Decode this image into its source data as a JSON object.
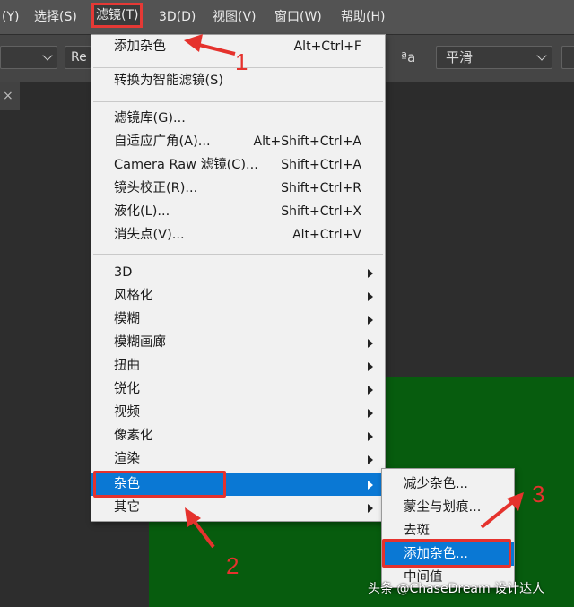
{
  "menubar": {
    "items": [
      {
        "label": "(Y)"
      },
      {
        "label": "选择(S)"
      },
      {
        "label": "滤镜(T)"
      },
      {
        "label": "3D(D)"
      },
      {
        "label": "视图(V)"
      },
      {
        "label": "窗口(W)"
      },
      {
        "label": "帮助(H)"
      }
    ]
  },
  "options_bar": {
    "font_style_value": "Re",
    "aa_icon": "aa-antialias-icon",
    "antialias_value": "平滑"
  },
  "tab": {
    "close_glyph": "×"
  },
  "filter_menu": {
    "items": [
      {
        "label": "添加杂色",
        "shortcut": "Alt+Ctrl+F"
      },
      {
        "label": "转换为智能滤镜(S)",
        "shortcut": ""
      },
      {
        "label": "滤镜库(G)...",
        "shortcut": ""
      },
      {
        "label": "自适应广角(A)...",
        "shortcut": "Alt+Shift+Ctrl+A"
      },
      {
        "label": "Camera Raw 滤镜(C)...",
        "shortcut": "Shift+Ctrl+A"
      },
      {
        "label": "镜头校正(R)...",
        "shortcut": "Shift+Ctrl+R"
      },
      {
        "label": "液化(L)...",
        "shortcut": "Shift+Ctrl+X"
      },
      {
        "label": "消失点(V)...",
        "shortcut": "Alt+Ctrl+V"
      },
      {
        "label": "3D"
      },
      {
        "label": "风格化"
      },
      {
        "label": "模糊"
      },
      {
        "label": "模糊画廊"
      },
      {
        "label": "扭曲"
      },
      {
        "label": "锐化"
      },
      {
        "label": "视频"
      },
      {
        "label": "像素化"
      },
      {
        "label": "渲染"
      },
      {
        "label": "杂色"
      },
      {
        "label": "其它"
      }
    ]
  },
  "noise_submenu": {
    "items": [
      {
        "label": "减少杂色..."
      },
      {
        "label": "蒙尘与划痕..."
      },
      {
        "label": "去斑"
      },
      {
        "label": "添加杂色..."
      },
      {
        "label": "中间值"
      }
    ]
  },
  "annotations": {
    "step1": "1",
    "step2": "2",
    "step3": "3"
  },
  "watermark": "头条 @ChaseDream 设计达人",
  "colors": {
    "accent": "#0a78d4",
    "annotation": "#e5322d",
    "canvas": "#075c0e"
  }
}
